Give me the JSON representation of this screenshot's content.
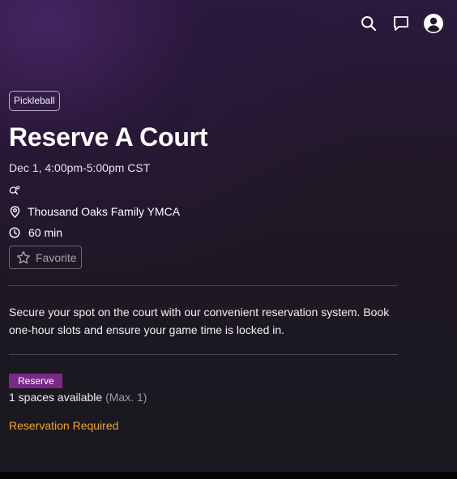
{
  "header": {
    "icons": [
      "search-icon",
      "chat-icon",
      "account-icon"
    ]
  },
  "event": {
    "category": "Pickleball",
    "title": "Reserve A Court",
    "datetime": "Dec 1, 4:00pm-5:00pm CST",
    "sport_icon": "pickleball-icon",
    "location": "Thousand Oaks Family YMCA",
    "duration": "60 min",
    "favorite_label": "Favorite",
    "description": "Secure your spot on the court with our convenient reservation system. Book one-hour slots and ensure your game time is locked in.",
    "reserve_label": "Reserve",
    "spaces_text": "1 spaces available",
    "max_text": "(Max. 1)",
    "reservation_required": "Reservation Required"
  },
  "colors": {
    "accent": "#7a2a86",
    "warning": "#f0a830",
    "background": "#1d1822"
  }
}
